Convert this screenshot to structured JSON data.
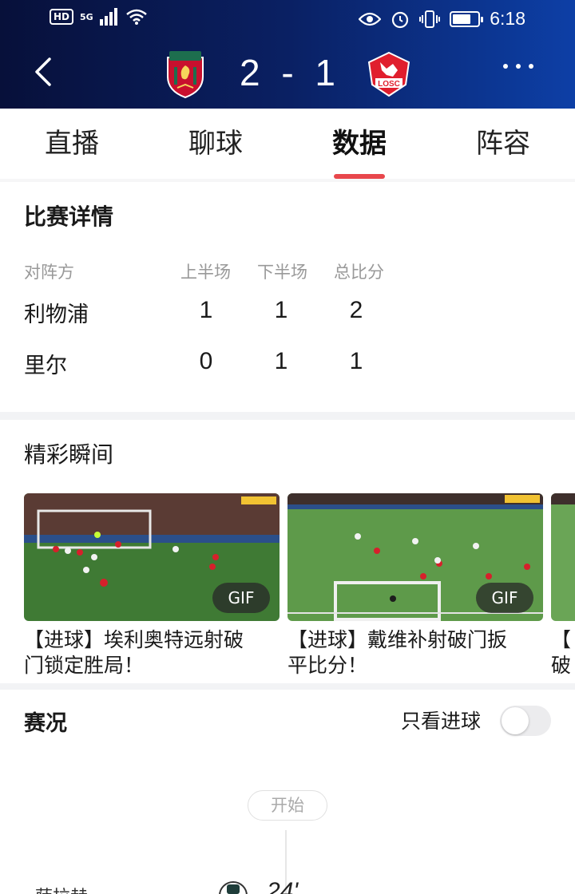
{
  "status_bar": {
    "hd": "HD",
    "signal": "5G",
    "time": "6:18",
    "battery_level": 0.72
  },
  "header": {
    "home_score": "2",
    "separator": "-",
    "away_score": "1",
    "home_crest": "liverpool-crest-icon",
    "away_crest": "losc-crest-icon",
    "away_crest_text": "LOSC",
    "colors": {
      "liverpool_red": "#c8102e",
      "losc_red": "#e01e2d"
    }
  },
  "tabs": [
    {
      "label": "直播",
      "active": false
    },
    {
      "label": "聊球",
      "active": false
    },
    {
      "label": "数据",
      "active": true
    },
    {
      "label": "阵容",
      "active": false
    }
  ],
  "match_detail": {
    "title": "比赛详情",
    "headers": [
      "对阵方",
      "上半场",
      "下半场",
      "总比分"
    ],
    "rows": [
      {
        "team": "利物浦",
        "first_half": "1",
        "second_half": "1",
        "total": "2"
      },
      {
        "team": "里尔",
        "first_half": "0",
        "second_half": "1",
        "total": "1"
      }
    ]
  },
  "highlights": {
    "title": "精彩瞬间",
    "items": [
      {
        "badge": "GIF",
        "caption_line1": "【进球】埃利奥特远射破",
        "caption_line2": "门锁定胜局！"
      },
      {
        "badge": "GIF",
        "caption_line1": "【进球】戴维补射破门扳",
        "caption_line2": "平比分！"
      },
      {
        "caption_line1": "【",
        "caption_line2": "破"
      }
    ]
  },
  "match_status": {
    "title": "赛况",
    "filter_label": "只看进球",
    "filter_on": false,
    "start_label": "开始",
    "first_event": {
      "player": "萨拉赫",
      "minute": "24'"
    }
  },
  "accent_color": "#e8474c"
}
